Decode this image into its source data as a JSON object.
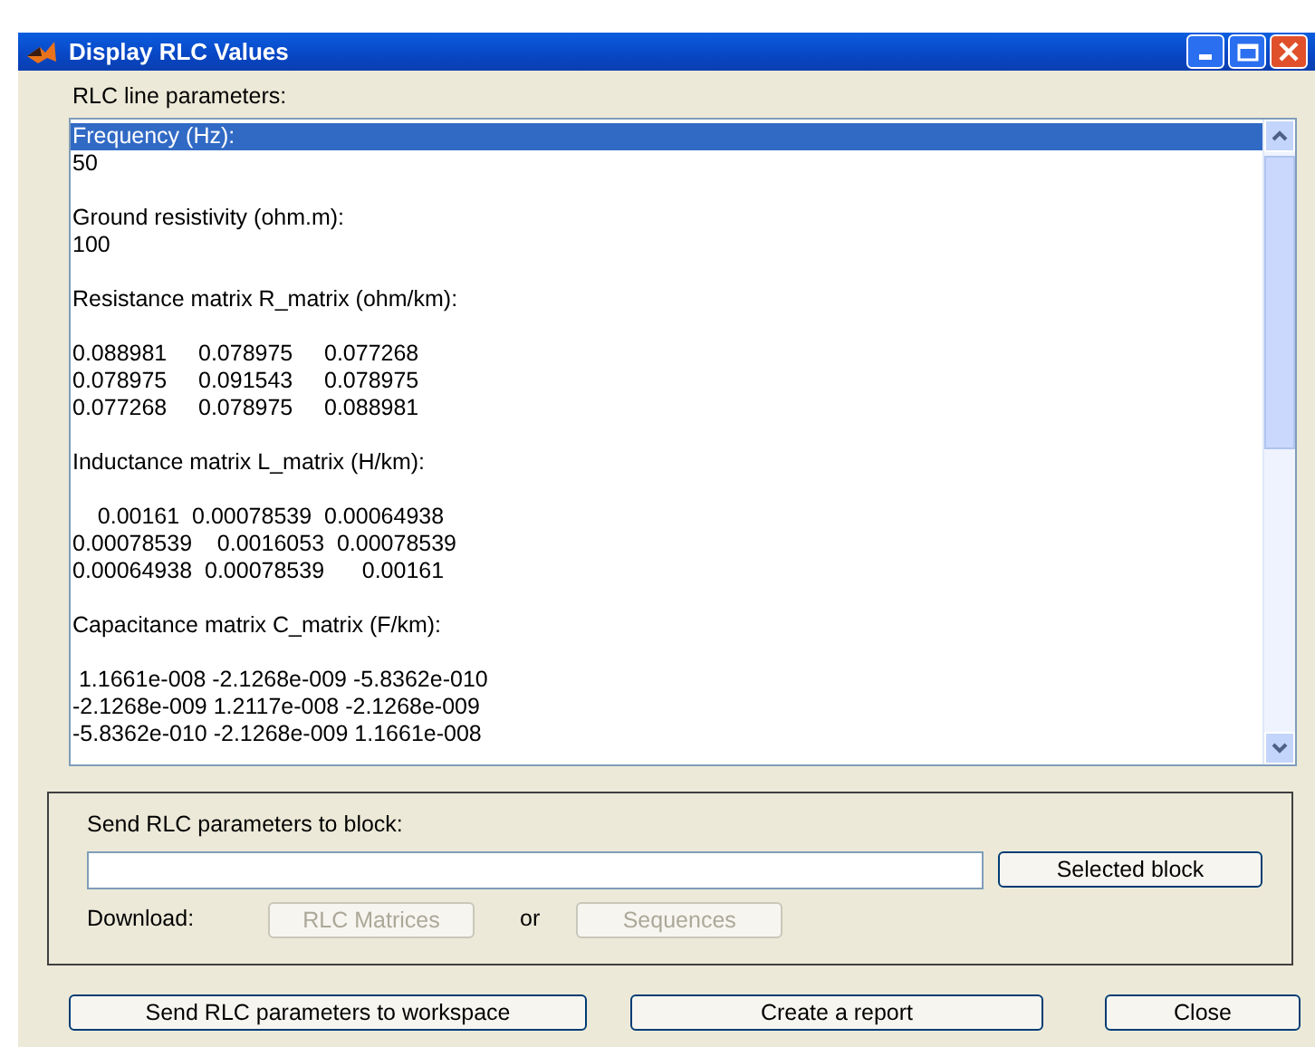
{
  "window": {
    "title": "Display RLC Values"
  },
  "list_label": "RLC line parameters:",
  "list": {
    "sections": [
      {
        "lines": [
          {
            "text": "Frequency (Hz):",
            "selected": true
          },
          {
            "text": "50",
            "selected": false
          }
        ]
      },
      {
        "lines": [
          {
            "text": "Ground resistivity (ohm.m):",
            "selected": false
          },
          {
            "text": "100",
            "selected": false
          }
        ]
      },
      {
        "lines": [
          {
            "text": "Resistance matrix R_matrix (ohm/km):",
            "selected": false
          }
        ]
      },
      {
        "lines": [
          {
            "text": "0.088981     0.078975     0.077268",
            "selected": false
          },
          {
            "text": "0.078975     0.091543     0.078975",
            "selected": false
          },
          {
            "text": "0.077268     0.078975     0.088981",
            "selected": false
          }
        ]
      },
      {
        "lines": [
          {
            "text": "Inductance matrix L_matrix (H/km):",
            "selected": false
          }
        ]
      },
      {
        "lines": [
          {
            "text": "    0.00161  0.00078539  0.00064938",
            "selected": false
          },
          {
            "text": "0.00078539    0.0016053  0.00078539",
            "selected": false
          },
          {
            "text": "0.00064938  0.00078539      0.00161",
            "selected": false
          }
        ]
      },
      {
        "lines": [
          {
            "text": "Capacitance matrix C_matrix (F/km):",
            "selected": false
          }
        ]
      },
      {
        "lines": [
          {
            "text": " 1.1661e-008 -2.1268e-009 -5.8362e-010",
            "selected": false
          },
          {
            "text": "-2.1268e-009 1.2117e-008 -2.1268e-009",
            "selected": false
          },
          {
            "text": "-5.8362e-010 -2.1268e-009 1.1661e-008",
            "selected": false
          }
        ]
      }
    ]
  },
  "block_panel": {
    "label": "Send RLC parameters to block:",
    "button": {
      "label": "Selected block",
      "disabled": false
    },
    "download_label": "Download:",
    "download_buttons": [
      {
        "label": "RLC Matrices",
        "disabled": true
      },
      {
        "label": "Sequences",
        "disabled": true
      }
    ],
    "or_text": "or"
  },
  "buttons": [
    {
      "label": "Send RLC parameters to workspace"
    },
    {
      "label": "Create a report"
    },
    {
      "label": "Close"
    }
  ]
}
